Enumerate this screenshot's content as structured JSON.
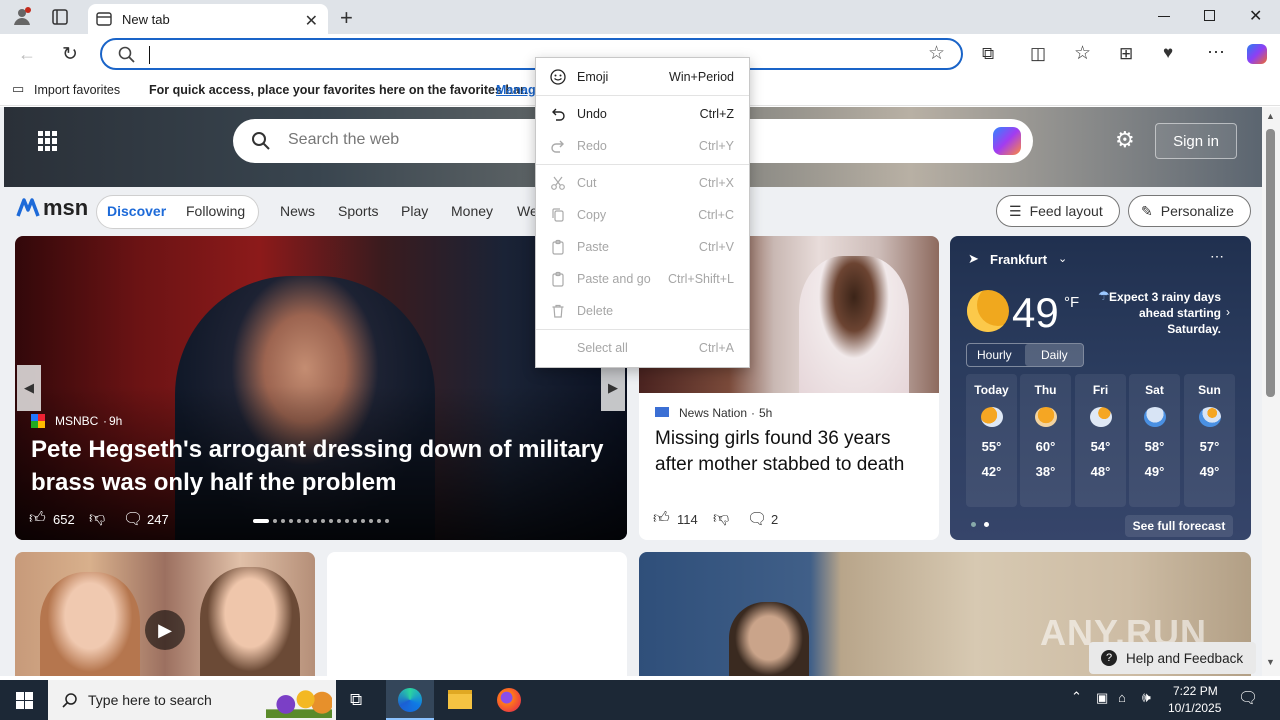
{
  "browser": {
    "tab_title": "New tab",
    "address_value": "",
    "favorites_import": "Import favorites",
    "favorites_hint": "For quick access, place your favorites here on the favorites bar.",
    "favorites_manage": "Manag"
  },
  "msn": {
    "search_placeholder": "Search the web",
    "sign_in": "Sign in",
    "logo": "msn",
    "tabs": [
      "Discover",
      "Following"
    ],
    "nav": [
      "News",
      "Sports",
      "Play",
      "Money",
      "We"
    ],
    "feed_layout": "Feed layout",
    "personalize": "Personalize"
  },
  "hero": {
    "source": "MSNBC",
    "age": "9h",
    "headline": "Pete Hegseth's arrogant dressing down of military brass was only half the problem",
    "likes": "652",
    "comments": "247"
  },
  "card2": {
    "source": "News Nation",
    "age": "5h",
    "headline": "Missing girls found 36 years after mother stabbed to death",
    "likes": "114",
    "comments": "2"
  },
  "weather": {
    "location": "Frankfurt",
    "temp": "49",
    "unit": "°F",
    "alert": "Expect 3 rainy days ahead starting Saturday.",
    "modes": [
      "Hourly",
      "Daily"
    ],
    "days": [
      {
        "d": "Today",
        "hi": "55°",
        "lo": "42°",
        "icon": "partly-sunny-rain-icon"
      },
      {
        "d": "Thu",
        "hi": "60°",
        "lo": "38°",
        "icon": "partly-cloudy-sun-icon"
      },
      {
        "d": "Fri",
        "hi": "54°",
        "lo": "48°",
        "icon": "partly-cloudy-sun-icon"
      },
      {
        "d": "Sat",
        "hi": "58°",
        "lo": "49°",
        "icon": "rain-icon"
      },
      {
        "d": "Sun",
        "hi": "57°",
        "lo": "49°",
        "icon": "rain-icon"
      }
    ],
    "see_full": "See full forecast"
  },
  "context_menu": {
    "items": [
      {
        "label": "Emoji",
        "shortcut": "Win+Period",
        "disabled": false
      },
      {
        "label": "Undo",
        "shortcut": "Ctrl+Z",
        "disabled": false
      },
      {
        "label": "Redo",
        "shortcut": "Ctrl+Y",
        "disabled": true
      },
      {
        "label": "Cut",
        "shortcut": "Ctrl+X",
        "disabled": true
      },
      {
        "label": "Copy",
        "shortcut": "Ctrl+C",
        "disabled": true
      },
      {
        "label": "Paste",
        "shortcut": "Ctrl+V",
        "disabled": true
      },
      {
        "label": "Paste and go",
        "shortcut": "Ctrl+Shift+L",
        "disabled": true
      },
      {
        "label": "Delete",
        "shortcut": "",
        "disabled": true
      },
      {
        "label": "Select all",
        "shortcut": "Ctrl+A",
        "disabled": true
      }
    ]
  },
  "feedback": "Help and Feedback",
  "watermark": "ANY.RUN",
  "taskbar": {
    "search_placeholder": "Type here to search",
    "time": "7:22 PM",
    "date": "10/1/2025"
  },
  "colors": {
    "accent": "#1a64c8",
    "discover": "#1d6ad8",
    "taskbar": "#1c2836"
  }
}
